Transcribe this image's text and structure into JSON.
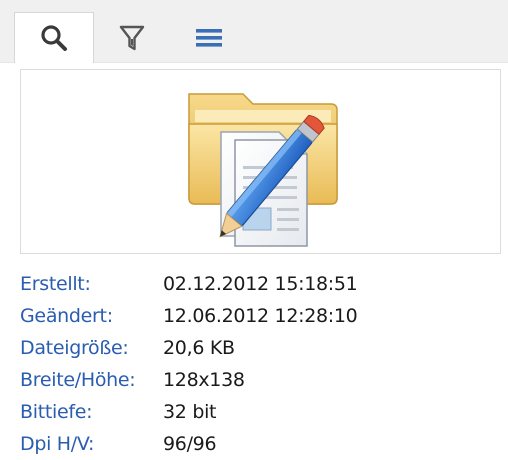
{
  "tabs": [
    {
      "icon": "search-icon",
      "active": true
    },
    {
      "icon": "filter-icon",
      "active": false
    },
    {
      "icon": "list-icon",
      "active": false
    }
  ],
  "preview": {
    "icon": "folder-edit-icon"
  },
  "info": {
    "rows": [
      {
        "label": "Erstellt:",
        "value": "02.12.2012 15:18:51"
      },
      {
        "label": "Geändert:",
        "value": "12.06.2012 12:28:10"
      },
      {
        "label": "Dateigröße:",
        "value": "20,6 KB"
      },
      {
        "label": "Breite/Höhe:",
        "value": "128x138"
      },
      {
        "label": "Bittiefe:",
        "value": "32 bit"
      },
      {
        "label": "Dpi H/V:",
        "value": "96/96"
      }
    ]
  },
  "colors": {
    "label": "#2a5db0",
    "value": "#1a1a1a",
    "tabbar": "#f0f0f0"
  }
}
